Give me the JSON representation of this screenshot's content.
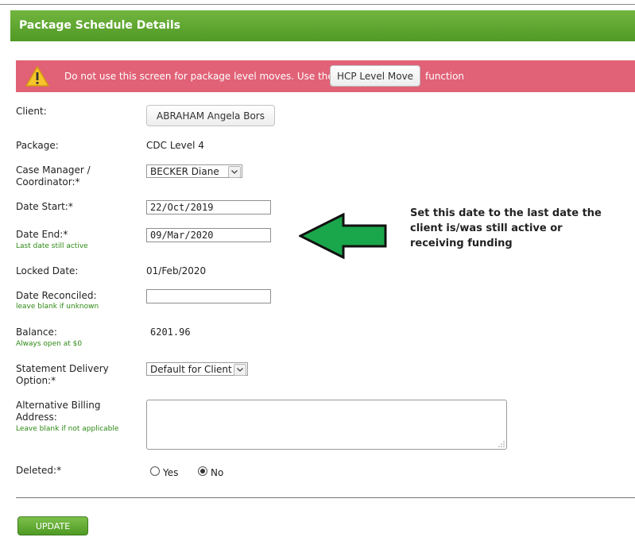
{
  "header": {
    "title": "Package Schedule Details"
  },
  "warning": {
    "icon": "warning-triangle-icon",
    "text_before": "Do not use this screen for package level moves. Use the",
    "button_label": "HCP Level Move",
    "text_after": "function"
  },
  "form": {
    "client": {
      "label": "Client:",
      "value": "ABRAHAM Angela Bors"
    },
    "package": {
      "label": "Package:",
      "value": "CDC Level 4"
    },
    "case_manager": {
      "label_line1": "Case Manager /",
      "label_line2": "Coordinator:*",
      "selected": "BECKER Diane"
    },
    "date_start": {
      "label": "Date Start:*",
      "value": "22/Oct/2019"
    },
    "date_end": {
      "label": "Date End:*",
      "hint": "Last date still active",
      "value": "09/Mar/2020"
    },
    "locked_date": {
      "label": "Locked Date:",
      "value": "01/Feb/2020"
    },
    "date_reconciled": {
      "label": "Date Reconciled:",
      "hint": "leave blank if unknown",
      "value": ""
    },
    "balance": {
      "label": "Balance:",
      "hint": "Always open at $0",
      "value": "6201.96"
    },
    "statement_delivery": {
      "label_line1": "Statement Delivery",
      "label_line2": "Option:*",
      "selected": "Default for Client"
    },
    "alt_billing": {
      "label_line1": "Alternative Billing",
      "label_line2": "Address:",
      "hint": "Leave blank if not applicable",
      "value": ""
    },
    "deleted": {
      "label": "Deleted:*",
      "options": [
        "Yes",
        "No"
      ],
      "selected": "No"
    }
  },
  "update_button": {
    "label": "UPDATE"
  },
  "annotation": {
    "text": "Set this date to the last date the client is/was still active or receiving funding",
    "arrow_color": "#1aa64a"
  },
  "colors": {
    "header_green": "#5aa52f",
    "warning_red": "#e16176",
    "hint_green": "#2d8a14"
  }
}
